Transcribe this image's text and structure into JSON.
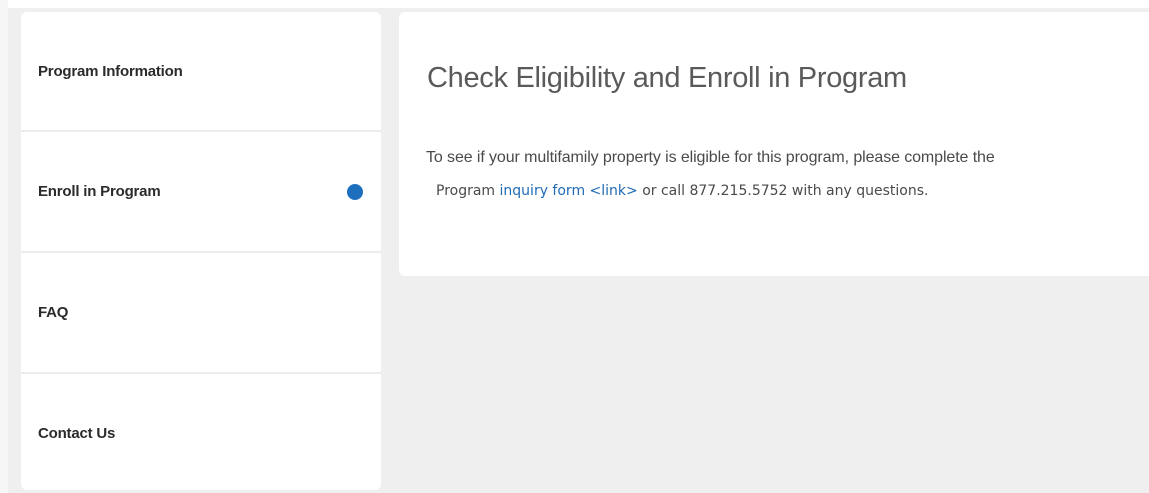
{
  "sidebar": {
    "items": [
      {
        "label": "Program Information",
        "active": false
      },
      {
        "label": "Enroll in Program",
        "active": true
      },
      {
        "label": "FAQ",
        "active": false
      },
      {
        "label": "Contact Us",
        "active": false
      }
    ]
  },
  "main": {
    "title": "Check Eligibility and Enroll in Program",
    "body_line1": "To see if your multifamily property is eligible for this program, please complete the",
    "body_line2": {
      "prefix": "Program ",
      "link_text": "inquiry form <link>",
      "suffix": " or call 877.215.5752 with any questions."
    }
  },
  "colors": {
    "accent": "#1f6fbf",
    "link": "#1f6bb5",
    "background": "#efefef"
  }
}
